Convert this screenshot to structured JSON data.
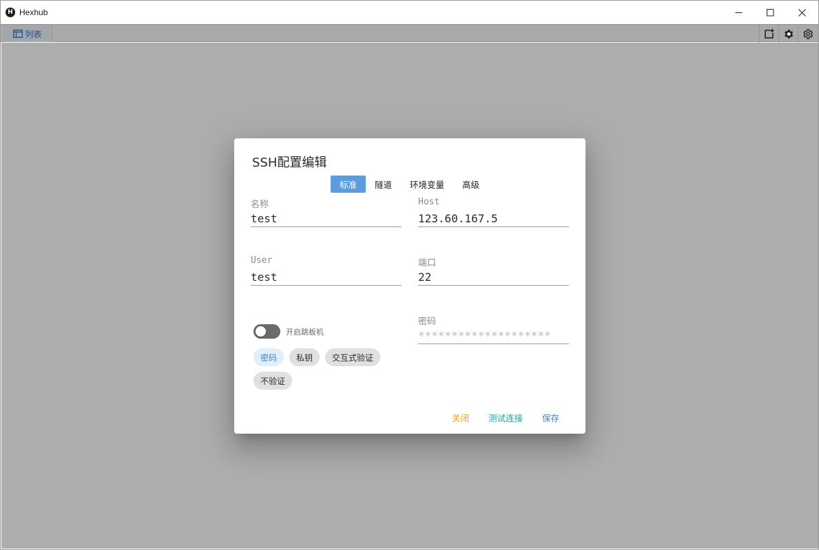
{
  "window": {
    "title": "Hexhub",
    "logo_letter": "H"
  },
  "toolbar": {
    "list_tab_label": "列表",
    "icons": [
      "new-window-icon",
      "gear-filled-icon",
      "settings-icon"
    ]
  },
  "dialog": {
    "title": "SSH配置编辑",
    "tabs": [
      {
        "label": "标准",
        "active": true
      },
      {
        "label": "隧道",
        "active": false
      },
      {
        "label": "环境变量",
        "active": false
      },
      {
        "label": "高级",
        "active": false
      }
    ],
    "fields": {
      "name": {
        "label": "名称",
        "value": "test"
      },
      "host": {
        "label": "Host",
        "value": "123.60.167.5"
      },
      "user": {
        "label": "User",
        "value": "test"
      },
      "port": {
        "label": "端口",
        "value": "22"
      },
      "password": {
        "label": "密码",
        "placeholder": "********************"
      }
    },
    "jump_switch": {
      "label": "开启跳板机",
      "on": false
    },
    "auth_chips": [
      {
        "label": "密码",
        "selected": true
      },
      {
        "label": "私钥",
        "selected": false
      },
      {
        "label": "交互式验证",
        "selected": false
      },
      {
        "label": "不验证",
        "selected": false
      }
    ],
    "actions": {
      "close": "关闭",
      "test": "测试连接",
      "save": "保存"
    }
  },
  "colors": {
    "tab_active": "#5b9bdf",
    "chip_selected_bg": "#e3eefb",
    "chip_selected_text": "#3b82d6",
    "close_btn": "#f0a11e",
    "test_btn": "#2aa198",
    "save_btn": "#3a86cf",
    "overlay": "#adadad"
  }
}
